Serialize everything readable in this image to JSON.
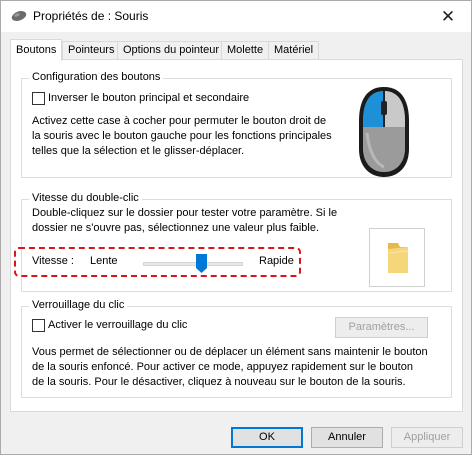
{
  "window": {
    "title": "Propriétés de : Souris",
    "close_glyph": "✕"
  },
  "tabs": [
    "Boutons",
    "Pointeurs",
    "Options du pointeur",
    "Molette",
    "Matériel"
  ],
  "buttons_config": {
    "title": "Configuration des boutons",
    "checkbox_label": "Inverser le bouton principal et secondaire",
    "checkbox_checked": false,
    "description": [
      "Activez cette case à cocher pour permuter le bouton droit de",
      "la souris avec le bouton gauche pour les fonctions principales",
      "telles que la sélection et le glisser-déplacer."
    ],
    "mouse_icon": "mouse-icon"
  },
  "double_click": {
    "title": "Vitesse du double-clic",
    "description": [
      "Double-cliquez sur le dossier pour tester votre paramètre. Si le",
      "dossier ne s'ouvre pas, sélectionnez une valeur plus faible."
    ],
    "speed_label": "Vitesse :",
    "slow_label": "Lente",
    "fast_label": "Rapide",
    "speed_value_fraction": 0.6,
    "folder_icon": "folder-icon",
    "highlight_color": "#d9141b"
  },
  "click_lock": {
    "title": "Verrouillage du clic",
    "checkbox_label": "Activer le verrouillage du clic",
    "checkbox_checked": false,
    "settings_button": "Paramètres...",
    "description": [
      "Vous permet de sélectionner ou de déplacer un élément sans maintenir le bouton",
      "de la souris enfoncé. Pour activer ce mode, appuyez rapidement sur le bouton",
      "de la souris. Pour le désactiver, cliquez à nouveau sur le bouton de la souris."
    ]
  },
  "footer": {
    "ok": "OK",
    "cancel": "Annuler",
    "apply": "Appliquer"
  }
}
